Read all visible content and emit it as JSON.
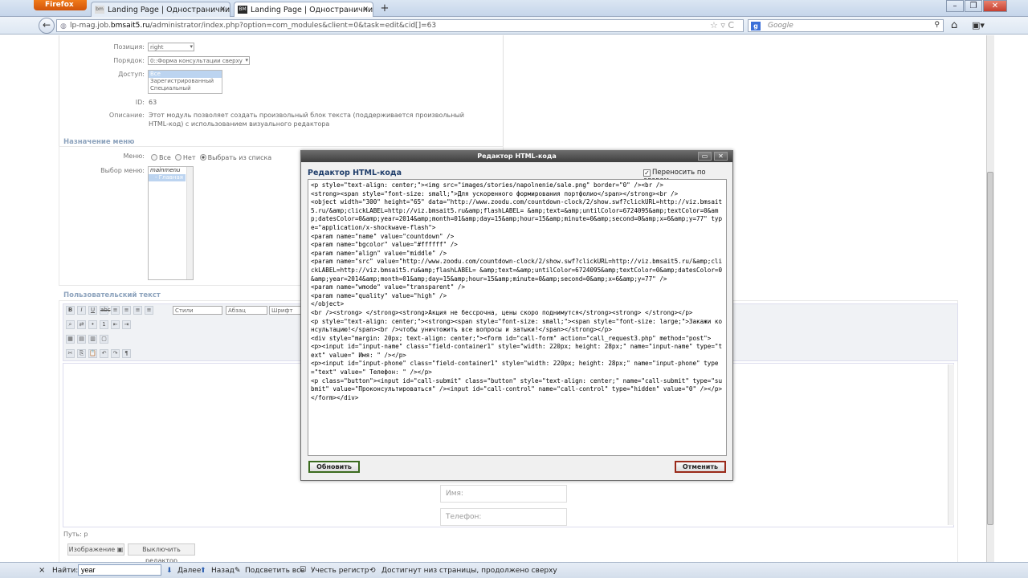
{
  "browser": {
    "menu_label": "Firefox",
    "tabs": [
      {
        "title": "Landing Page | Одностраничник | Б...",
        "favicon": "bm"
      },
      {
        "title": "Landing Page | Одностраничник | Б...",
        "favicon": "BM"
      }
    ],
    "new_tab": "+",
    "url_prefix": "lp-mag.job.",
    "url_domain": "bmsait5.ru",
    "url_path": "/administrator/index.php?option=com_modules&client=0&task=edit&cid[]=63",
    "search_engine": "g",
    "search_placeholder": "Google"
  },
  "form": {
    "position_label": "Позиция:",
    "position_value": "right",
    "order_label": "Порядок:",
    "order_value": "0::Форма консультации сверху",
    "access_label": "Доступ:",
    "access_options": [
      "Все",
      "Зарегистрированный",
      "Специальный"
    ],
    "id_label": "ID:",
    "id_value": "63",
    "desc_label": "Описание:",
    "desc_value": "Этот модуль позволяет создать произвольный блок текста (поддерживается произвольный HTML-код) с использованием визуального редактора"
  },
  "menu_section": {
    "title": "Назначение меню",
    "menu_label": "Меню:",
    "radio_all": "Все",
    "radio_none": "Нет",
    "radio_select": "Выбрать из списка",
    "select_label": "Выбор меню:",
    "select_heading": "mainmenu",
    "select_item": "- Главная"
  },
  "custom_section": {
    "title": "Пользовательский текст",
    "styles_label": "Стили",
    "format_label": "Абзац",
    "font_label": "Шрифт",
    "path_label": "Путь: p",
    "image_button": "Изображение",
    "toggle_button": "Выключить редактор",
    "name_placeholder": "Имя:",
    "phone_placeholder": "Телефон:"
  },
  "modal": {
    "header": "Редактор HTML-кода",
    "title": "Редактор HTML-кода",
    "wrap_label": "Переносить по словам",
    "wrap_checked": "✓",
    "code": "<p style=\"text-align: center;\"><img src=\"images/stories/napolnenie/sale.png\" border=\"0\" /><br />\n<strong><span style=\"font-size: small;\">Для ускоренного формирования портфолио</span></strong><br />\n<object width=\"300\" height=\"65\" data=\"http://www.zoodu.com/countdown-clock/2/show.swf?clickURL=http://viz.bmsait5.ru/&amp;clickLABEL=http://viz.bmsait5.ru&amp;flashLABEL= &amp;text=&amp;untilColor=6724095&amp;textColor=0&amp;datesColor=0&amp;year=2014&amp;month=01&amp;day=15&amp;hour=15&amp;minute=0&amp;second=0&amp;x=6&amp;y=77\" type=\"application/x-shockwave-flash\">\n<param name=\"name\" value=\"countdown\" />\n<param name=\"bgcolor\" value=\"#ffffff\" />\n<param name=\"align\" value=\"middle\" />\n<param name=\"src\" value=\"http://www.zoodu.com/countdown-clock/2/show.swf?clickURL=http://viz.bmsait5.ru/&amp;clickLABEL=http://viz.bmsait5.ru&amp;flashLABEL= &amp;text=&amp;untilColor=6724095&amp;textColor=0&amp;datesColor=0&amp;year=2014&amp;month=01&amp;day=15&amp;hour=15&amp;minute=0&amp;second=0&amp;x=6&amp;y=77\" />\n<param name=\"wmode\" value=\"transparent\" />\n<param name=\"quality\" value=\"high\" />\n</object>\n<br /><strong> </strong><strong>Акция не бессрочна, цены скоро поднимутся</strong><strong> </strong></p>\n<p style=\"text-align: center;\"><strong><span style=\"font-size: small;\"><span style=\"font-size: large;\">Закажи консультацию!</span><br />чтобы уничтожить все вопросы и затыки!</span></strong></p>\n<div style=\"margin: 20px; text-align: center;\"><form id=\"call-form\" action=\"call_request3.php\" method=\"post\">\n<p><input id=\"input-name\" class=\"field-container1\" style=\"width: 220px; height: 28px;\" name=\"input-name\" type=\"text\" value=\" Имя: \" /></p>\n<p><input id=\"input-phone\" class=\"field-container1\" style=\"width: 220px; height: 28px;\" name=\"input-phone\" type=\"text\" value=\" Телефон: \" /></p>\n<p class=\"button\"><input id=\"call-submit\" class=\"button\" style=\"text-align: center;\" name=\"call-submit\" type=\"submit\" value=\"Проконсультироваться\" /><input id=\"call-control\" name=\"call-control\" type=\"hidden\" value=\"0\" /></p>\n</form></div>",
    "update_button": "Обновить",
    "cancel_button": "Отменить"
  },
  "findbar": {
    "close": "×",
    "label": "Найти:",
    "query": "year",
    "next": "Далее",
    "prev": "Назад",
    "highlight": "Подсветить все",
    "match_case": "Учесть регистр",
    "status": "Достигнут низ страницы, продолжено сверху"
  }
}
